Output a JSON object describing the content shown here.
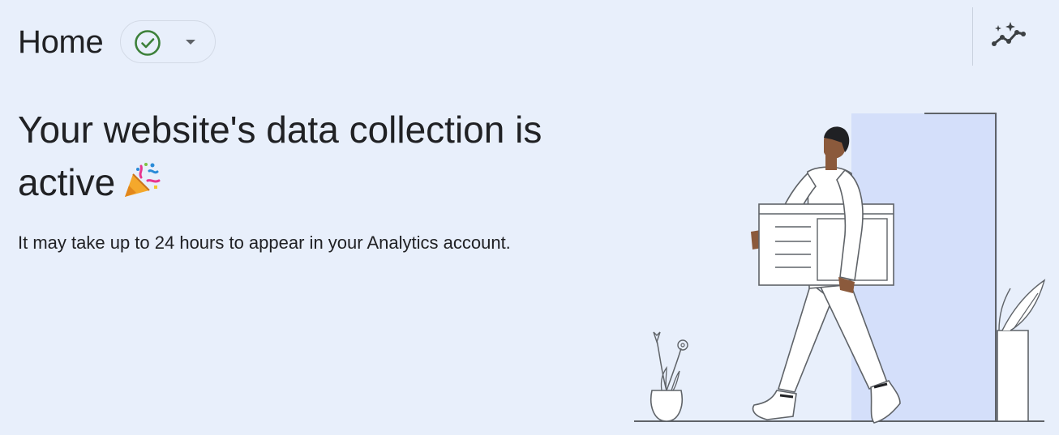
{
  "header": {
    "title": "Home",
    "status_icon": "check-circle-icon",
    "status_color": "#3c8039",
    "dropdown_icon": "caret-down-icon",
    "insights_icon": "insights-sparkle-icon"
  },
  "main": {
    "headline": "Your website's data collection is active",
    "headline_emoji_icon": "party-popper-icon",
    "subtext": "It may take up to 24 hours to appear in your Analytics account."
  },
  "illustration": {
    "description_icon": "person-carrying-browser-window-illustration"
  },
  "colors": {
    "background": "#e8effb",
    "door_panel": "#d4dffa",
    "text": "#202124",
    "skin": "#8b5a3c"
  }
}
